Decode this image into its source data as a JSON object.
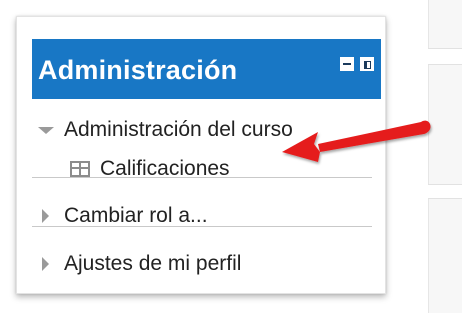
{
  "block": {
    "title": "Administración",
    "header_bg": "#1877c5",
    "controls": [
      {
        "name": "minimize-icon"
      },
      {
        "name": "dock-icon"
      }
    ]
  },
  "tree": {
    "course_admin": {
      "label": "Administración del curso",
      "expanded": true,
      "children": [
        {
          "label": "Calificaciones",
          "icon": "grades-table-icon"
        }
      ]
    },
    "items": [
      {
        "label": "Cambiar rol a..."
      },
      {
        "label": "Ajustes de mi perfil"
      }
    ]
  },
  "annotation": {
    "icon": "red-arrow-icon",
    "color": "#e51c1c",
    "points_to": "Calificaciones"
  }
}
